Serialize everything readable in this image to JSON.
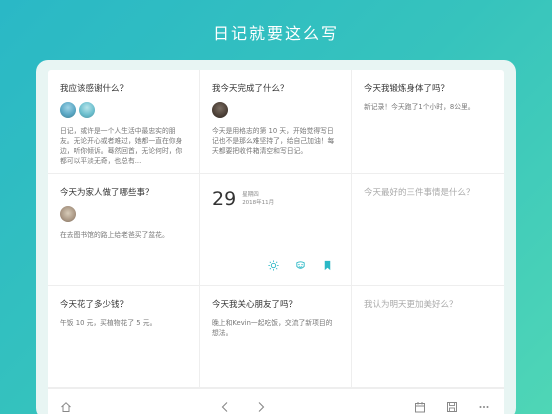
{
  "headline": "日记就要这么写",
  "cards": [
    {
      "question": "我应该感谢什么？",
      "text": "日记，或许是一个人生活中最忠实的朋友。无论开心或者难过，她都一直在你身边，听你倾诉。蓦然回首，无论何时，你都可以平淡无奇，也总有..."
    },
    {
      "question": "我今天完成了什么？",
      "text": "今天是用格志的第 10 天，开始觉得写日记也不是那么难坚持了，给自己加油！每天都要把收件箱清空和写日记。"
    },
    {
      "question": "今天我锻炼身体了吗？",
      "text": "新记录！今天跑了1个小时，8公里。"
    },
    {
      "question": "今天为家人做了哪些事？",
      "text": "在去图书馆的路上给老爸买了盆花。"
    },
    {
      "date_number": "29",
      "weekday": "星期四",
      "month": "2018年11月"
    },
    {
      "question": "今天最好的三件事情是什么？",
      "text": ""
    },
    {
      "question": "今天花了多少钱？",
      "text": "午饭 10 元，买植物花了 5 元。"
    },
    {
      "question": "今天我关心朋友了吗？",
      "text": "晚上和Kevin一起吃饭，交流了新项目的想法。"
    },
    {
      "question": "我认为明天更加美好么？",
      "text": ""
    }
  ],
  "colors": {
    "accent": "#2ab8c6",
    "card_text": "#777777"
  },
  "icons": [
    "sun-icon",
    "smile-icon",
    "bookmark-icon",
    "home-icon",
    "chevron-left-icon",
    "chevron-right-icon",
    "calendar-icon",
    "save-icon",
    "more-icon"
  ]
}
